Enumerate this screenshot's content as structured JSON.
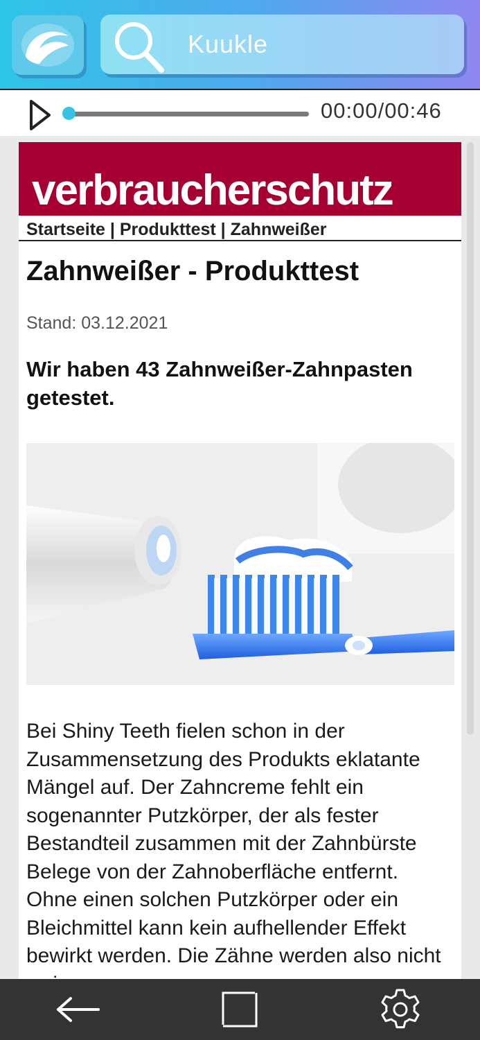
{
  "app": {
    "search_placeholder": "Kuukle"
  },
  "player": {
    "time": "00:00/00:46",
    "progress": 0
  },
  "page": {
    "banner": "verbraucherschutz",
    "breadcrumb": "Startseite | Produkttest | Zahnweißer",
    "title": "Zahnweißer - Produkttest",
    "date": "Stand: 03.12.2021",
    "subhead": "Wir haben 43 Zahnweißer-Zahnpasten getestet.",
    "image_alt": "toothpaste-toothbrush-photo",
    "body": "Bei Shiny Teeth fielen schon in der Zusammensetzung des Produkts eklatante Mängel auf. Der Zahncreme fehlt ein sogenannter Putzkörper, der als fester Bestandteil zusammen mit der Zahnbürste Belege von der Zahnoberfläche entfernt. Ohne einen solchen Putzkörper oder ein Bleichmittel kann kein aufhellender Effekt bewirkt werden. Die Zähne werden also nicht wei"
  },
  "colors": {
    "banner": "#a60033",
    "accent": "#36c2e2"
  },
  "icons": [
    "app-logo-icon",
    "search-icon",
    "play-icon",
    "back-arrow-icon",
    "recents-icon",
    "settings-gear-icon"
  ]
}
